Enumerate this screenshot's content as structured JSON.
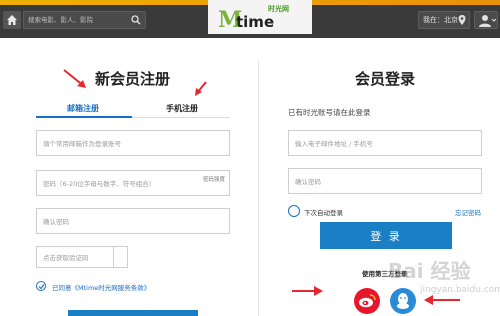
{
  "header": {
    "search_placeholder": "搜索电影、影人、影院",
    "logo_m": "M",
    "logo_time": "time",
    "logo_cn": "时光网",
    "city_label": "我在：北京"
  },
  "register": {
    "title": "新会员注册",
    "tabs": [
      {
        "label": "邮箱注册",
        "active": true
      },
      {
        "label": "手机注册",
        "active": false
      }
    ],
    "email_placeholder": "填个常用邮箱作为登录账号",
    "password_placeholder": "密码（6-20位字母与数字、符号组合）",
    "password_strength_label": "密码强度",
    "confirm_placeholder": "确认密码",
    "captcha_placeholder": "点击获取验证码",
    "agree_text": "已同意《Mtime时光网服务条款》"
  },
  "login": {
    "title": "会员登录",
    "hint": "已有时光账号请在此登录",
    "account_placeholder": "输入电子邮件地址 / 手机号",
    "password_placeholder": "确认密码",
    "auto_login": "下次自动登录",
    "forgot": "忘记密码",
    "login_button": "登 录",
    "third_party_title": "使用第三方登录"
  },
  "watermark": {
    "main": "Bai 经验",
    "sub": "jingyan.baidu.com"
  },
  "colors": {
    "accent": "#1a7fc4",
    "header_bg": "#3a3a3a",
    "arrow_red": "#e8262d",
    "weibo_red": "#e6162d",
    "qq_blue": "#2a8bd6"
  }
}
